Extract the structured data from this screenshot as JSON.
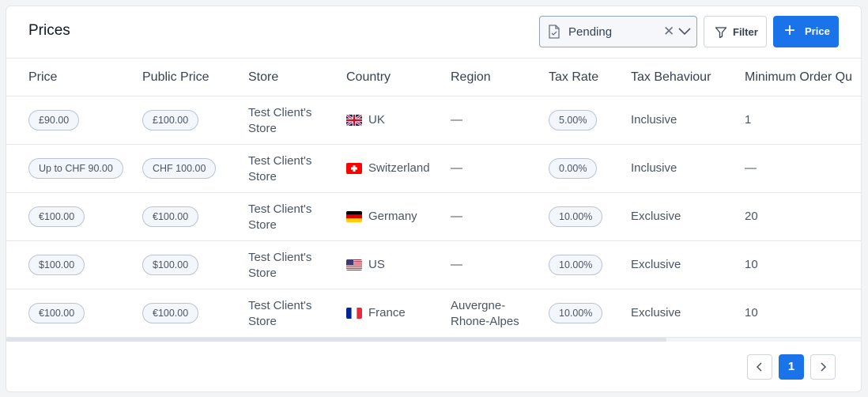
{
  "header": {
    "title": "Prices",
    "status_filter": {
      "value": "Pending"
    },
    "filter_label": "Filter",
    "add_price_label": "Price"
  },
  "table": {
    "columns": [
      "Price",
      "Public Price",
      "Store",
      "Country",
      "Region",
      "Tax Rate",
      "Tax Behaviour",
      "Minimum Order Qu"
    ],
    "rows": [
      {
        "price": "£90.00",
        "public_price": "£100.00",
        "store": [
          "Test Client's",
          "Store"
        ],
        "country": "UK",
        "flag": "uk-flag-icon",
        "region": [
          "—"
        ],
        "tax_rate": "5.00%",
        "tax_behaviour": "Inclusive",
        "min_order": "1"
      },
      {
        "price": "Up to CHF 90.00",
        "public_price": "CHF 100.00",
        "store": [
          "Test Client's",
          "Store"
        ],
        "country": "Switzerland",
        "flag": "switzerland-flag-icon",
        "region": [
          "—"
        ],
        "tax_rate": "0.00%",
        "tax_behaviour": "Inclusive",
        "min_order": "—"
      },
      {
        "price": "€100.00",
        "public_price": "€100.00",
        "store": [
          "Test Client's",
          "Store"
        ],
        "country": "Germany",
        "flag": "germany-flag-icon",
        "region": [
          "—"
        ],
        "tax_rate": "10.00%",
        "tax_behaviour": "Exclusive",
        "min_order": "20"
      },
      {
        "price": "$100.00",
        "public_price": "$100.00",
        "store": [
          "Test Client's",
          "Store"
        ],
        "country": "US",
        "flag": "us-flag-icon",
        "region": [
          "—"
        ],
        "tax_rate": "10.00%",
        "tax_behaviour": "Exclusive",
        "min_order": "10"
      },
      {
        "price": "€100.00",
        "public_price": "€100.00",
        "store": [
          "Test Client's",
          "Store"
        ],
        "country": "France",
        "flag": "france-flag-icon",
        "region": [
          "Auvergne-",
          "Rhone-Alpes"
        ],
        "tax_rate": "10.00%",
        "tax_behaviour": "Exclusive",
        "min_order": "10"
      }
    ]
  },
  "pagination": {
    "current_page": "1"
  },
  "colors": {
    "accent": "#1a73e8",
    "border": "#e5e7eb",
    "pill_border": "#b9c3d6"
  }
}
